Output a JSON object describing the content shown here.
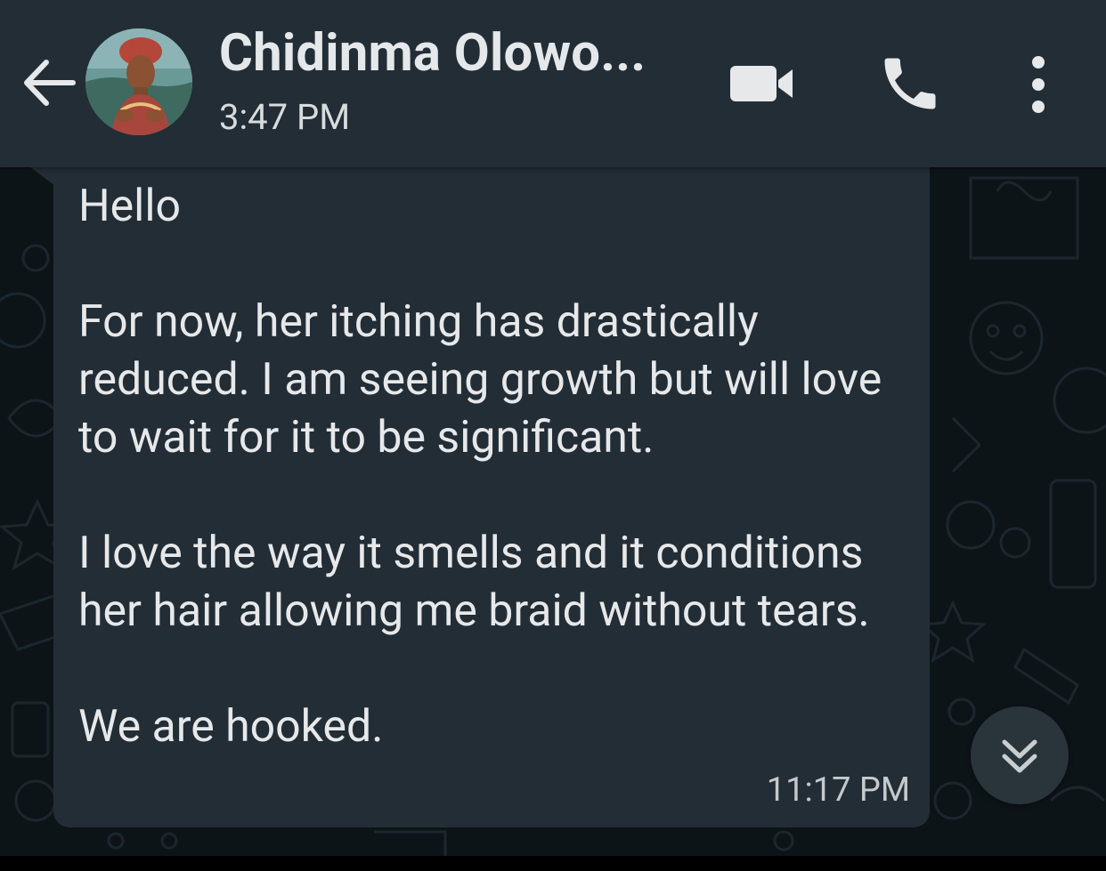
{
  "header": {
    "contact_name": "Chidinma Olowo...",
    "status": "3:47 PM"
  },
  "message": {
    "paragraphs": [
      "Hello",
      "For now, her itching has drastically reduced. I am seeing growth but will love to wait for it to be significant.",
      "I love the way it smells and it conditions her hair allowing me braid without tears.",
      "We are hooked."
    ],
    "time": "11:17 PM"
  },
  "icons": {
    "back": "arrow-back-icon",
    "video": "videocam-icon",
    "call": "phone-icon",
    "menu": "more-vert-icon",
    "scroll": "double-chevron-down-icon"
  },
  "colors": {
    "header_bg": "#232d36",
    "chat_bg": "#0d1418",
    "bubble_bg": "#232d36",
    "text": "#e6e8e9"
  }
}
